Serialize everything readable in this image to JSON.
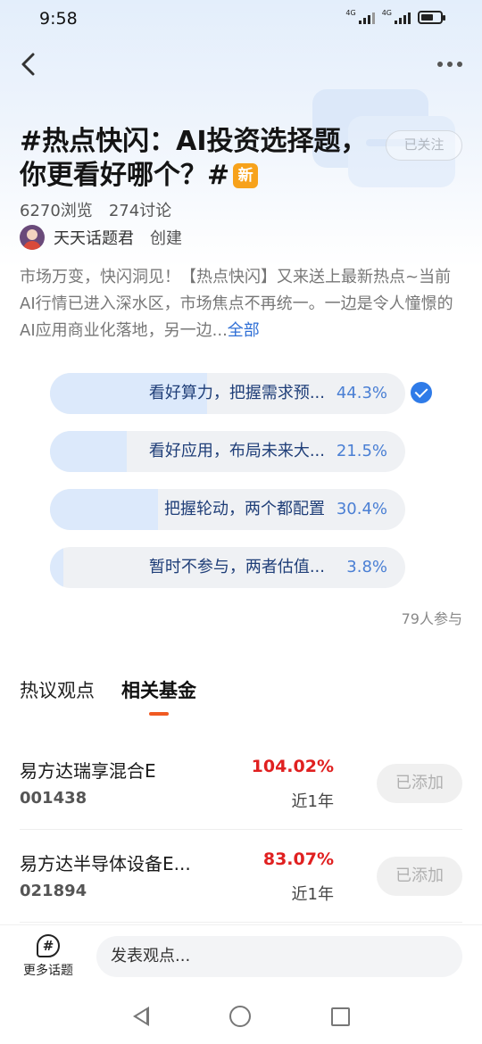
{
  "status_bar": {
    "time": "9:58",
    "net1": "4G",
    "net2": "4G"
  },
  "nav": {
    "back_icon": "chevron-left-icon",
    "more_icon": "more-dots-icon"
  },
  "topic": {
    "title": "#热点快闪：AI投资选择题，你更看好哪个？#",
    "new_badge": "新",
    "follow_label": "已关注",
    "views": "6270浏览",
    "discussions": "274讨论",
    "creator_name": "天天话题君",
    "creator_role": "创建",
    "description": "市场万变，快闪洞见！【热点快闪】又来送上最新热点~当前AI行情已进入深水区，市场焦点不再统一。一边是令人憧憬的AI应用商业化落地，另一边...",
    "description_more": "全部"
  },
  "poll": {
    "options": [
      {
        "label": "看好算力，把握需求预...",
        "percent": "44.3%",
        "value": 44.3,
        "selected": true
      },
      {
        "label": "看好应用，布局未来大...",
        "percent": "21.5%",
        "value": 21.5,
        "selected": false
      },
      {
        "label": "把握轮动，两个都配置",
        "percent": "30.4%",
        "value": 30.4,
        "selected": false
      },
      {
        "label": "暂时不参与，两者估值...",
        "percent": "3.8%",
        "value": 3.8,
        "selected": false
      }
    ],
    "participants": "79人参与"
  },
  "tabs": [
    {
      "label": "热议观点",
      "active": false
    },
    {
      "label": "相关基金",
      "active": true
    }
  ],
  "funds": [
    {
      "name": "易方达瑞享混合E",
      "code": "001438",
      "return": "104.02%",
      "period": "近1年",
      "button": "已添加"
    },
    {
      "name": "易方达半导体设备E...",
      "code": "021894",
      "return": "83.07%",
      "period": "近1年",
      "button": "已添加"
    }
  ],
  "bottom_bar": {
    "more_topics_label": "更多话题",
    "more_topics_icon": "hash-bubble-icon",
    "input_placeholder": "发表观点..."
  },
  "colors": {
    "accent": "#2f7be8",
    "tab_indicator": "#f05a22",
    "return_red": "#e02020",
    "badge": "#f7a21b"
  }
}
